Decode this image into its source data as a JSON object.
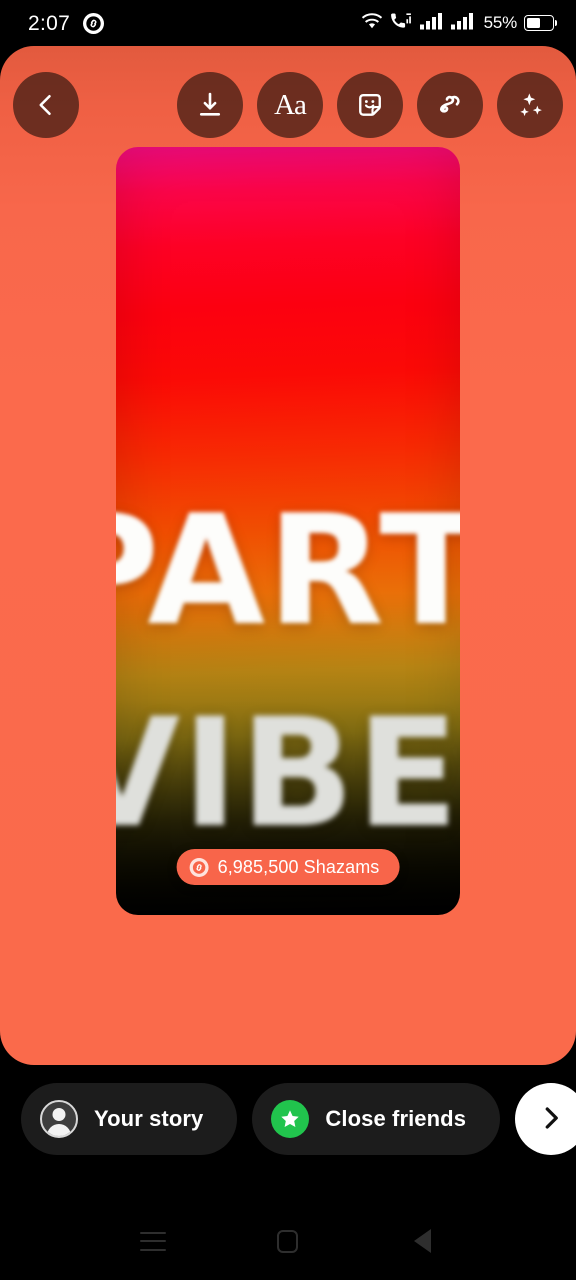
{
  "status_bar": {
    "time": "2:07",
    "notification_icon": "shazam-icon",
    "wifi_icon": "wifi-icon",
    "vowifi_icon": "volte-wifi-calling-icon",
    "signal1_icon": "cellular-signal-icon",
    "signal2_icon": "cellular-signal-icon",
    "battery_percent": "55%",
    "battery_level": 55
  },
  "toolbar": {
    "back_label": "Back",
    "back_icon": "chevron-left-icon",
    "save_label": "Save",
    "save_icon": "download-icon",
    "text_label": "Aa",
    "text_icon": "text-tool-icon",
    "sticker_label": "Stickers",
    "sticker_icon": "sticker-icon",
    "draw_label": "Draw",
    "draw_icon": "squiggle-draw-icon",
    "effects_label": "Effects",
    "effects_icon": "sparkles-icon"
  },
  "story_card": {
    "word_top": "PARTY",
    "word_bottom": "VIBES",
    "shazam_chip": {
      "icon": "shazam-icon",
      "count": "6,985,500",
      "label": "6,985,500 Shazams"
    },
    "gradient_top_color": "#f60b80",
    "gradient_mid_color": "#fc0010",
    "gradient_low_color": "#dda018",
    "gradient_bottom_color": "#0a0a02"
  },
  "share_bar": {
    "your_story_label": "Your story",
    "your_story_icon": "avatar-icon",
    "close_friends_label": "Close friends",
    "close_friends_icon": "green-star-icon",
    "close_friends_color": "#21c44d",
    "next_label": "Next",
    "next_icon": "chevron-right-icon"
  },
  "nav_bar": {
    "recents_label": "Recents",
    "recents_icon": "menu-icon",
    "home_label": "Home",
    "home_icon": "square-icon",
    "back_label": "Back",
    "back_icon": "triangle-left-icon"
  },
  "theme": {
    "panel_accent": "#fa6a4b",
    "chip_color": "#f8654a",
    "toolbar_button_color": "#3a1a12"
  }
}
